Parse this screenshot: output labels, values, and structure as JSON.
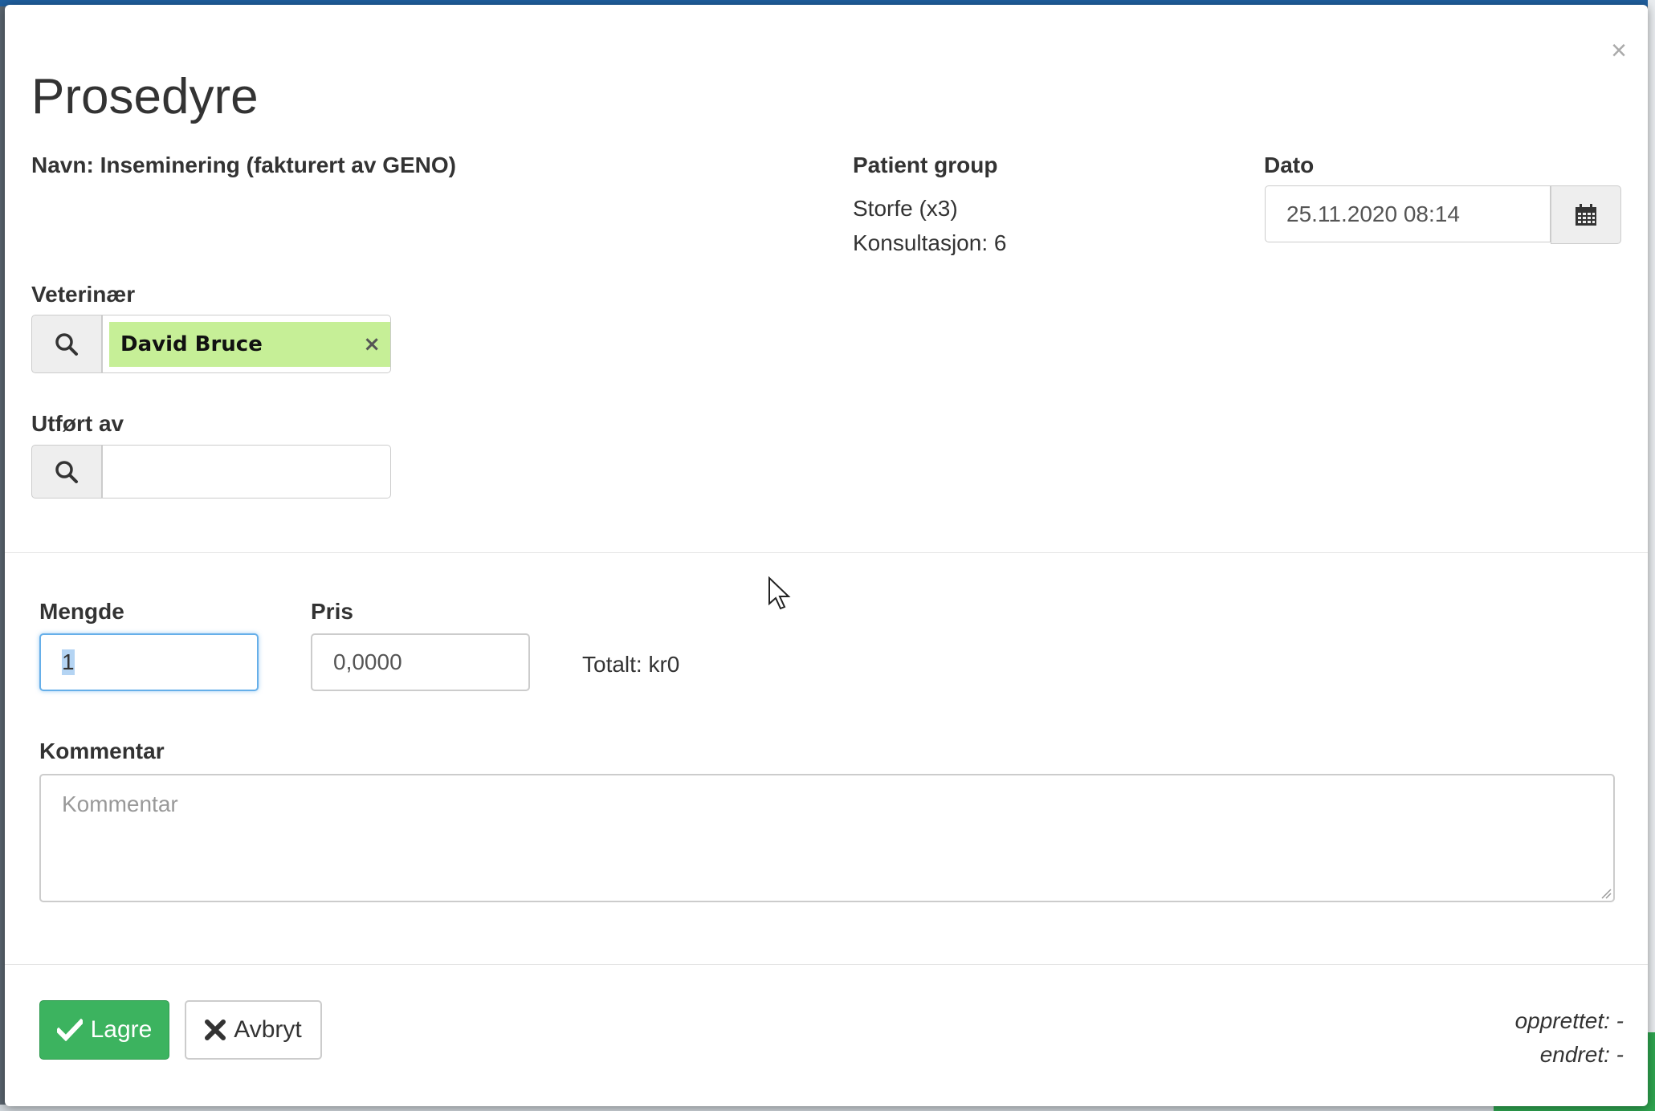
{
  "modal": {
    "title": "Prosedyre",
    "close_label": "×"
  },
  "procedure": {
    "name_text": "Navn: Inseminering (fakturert av GENO)"
  },
  "patient_group": {
    "label": "Patient group",
    "value": "Storfe (x3)",
    "consultation": "Konsultasjon: 6"
  },
  "date": {
    "label": "Dato",
    "value": "25.11.2020 08:14"
  },
  "veterinarian": {
    "label": "Veterinær",
    "selected": "David Bruce",
    "remove_label": "×"
  },
  "performed_by": {
    "label": "Utført av",
    "value": ""
  },
  "quantity": {
    "label": "Mengde",
    "value": "1"
  },
  "price": {
    "label": "Pris",
    "value": "0,0000"
  },
  "total": {
    "text": "Totalt: kr0"
  },
  "comment": {
    "label": "Kommentar",
    "placeholder": "Kommentar"
  },
  "actions": {
    "save_label": "Lagre",
    "cancel_label": "Avbryt"
  },
  "meta": {
    "created": "opprettet: -",
    "modified": "endret: -"
  },
  "colors": {
    "save_button": "#3cb35f",
    "selected_tag": "#c6ef97",
    "focus_border": "#66afe9"
  },
  "icons": [
    "search-icon",
    "calendar-icon",
    "check-icon",
    "times-icon",
    "close-icon"
  ]
}
